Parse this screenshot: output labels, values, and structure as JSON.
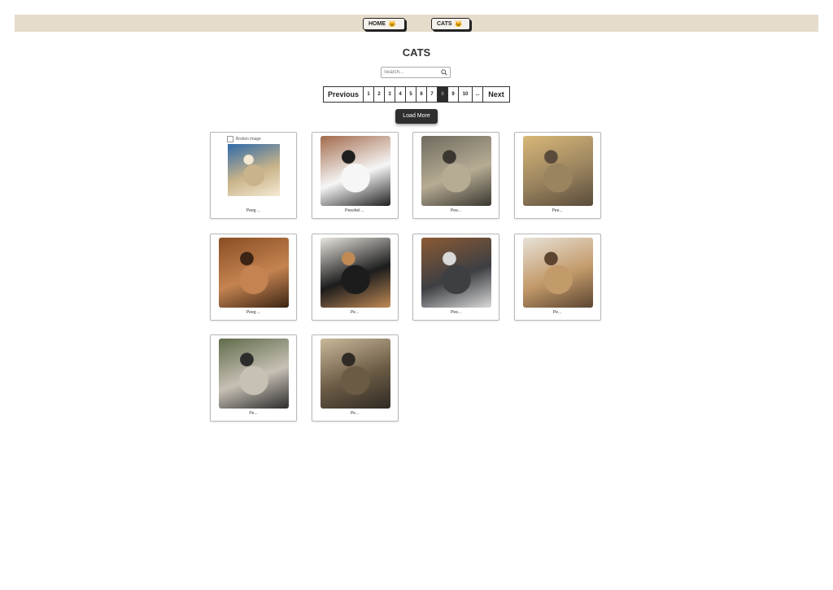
{
  "nav": {
    "home_label": "HOME",
    "cats_label": "CATS",
    "home_icon": "cat-icon",
    "cats_icon": "cat-icon"
  },
  "page": {
    "title": "CATS"
  },
  "search": {
    "placeholder": "Search..."
  },
  "pagination": {
    "previous_label": "Previous",
    "next_label": "Next",
    "pages": [
      "1",
      "2",
      "3",
      "4",
      "5",
      "6",
      "7",
      "8",
      "9",
      "10",
      "..."
    ],
    "active_page": "8"
  },
  "load_more": {
    "label": "Load More"
  },
  "cards": [
    {
      "caption": "Peeg ... ",
      "alt": "Broken image",
      "has_broken_image": true,
      "colors": [
        "#2e6aa8",
        "#c9b38a",
        "#f3e9d2"
      ]
    },
    {
      "caption": "Peeshel ...",
      "colors": [
        "#a26a4b",
        "#f6f6f6",
        "#1f1f1f"
      ]
    },
    {
      "caption": "Pee...",
      "colors": [
        "#6e6a5e",
        "#b6ac94",
        "#3a3730"
      ]
    },
    {
      "caption": "Pee...",
      "colors": [
        "#d8b777",
        "#9a845f",
        "#5a4b3a"
      ]
    },
    {
      "caption": "Peeg ...",
      "colors": [
        "#8a4e24",
        "#c48350",
        "#3b2414"
      ]
    },
    {
      "caption": "Pe...",
      "colors": [
        "#e9e6df",
        "#1c1c1c",
        "#c08a55"
      ]
    },
    {
      "caption": "Pee...",
      "colors": [
        "#8b5a34",
        "#3d3f43",
        "#d9d9d9"
      ]
    },
    {
      "caption": "Pe...",
      "colors": [
        "#e7e1d7",
        "#c39a6a",
        "#5b4531"
      ]
    },
    {
      "caption": "Pe...",
      "colors": [
        "#5f6b4a",
        "#c7c0b5",
        "#2c2c2c"
      ]
    },
    {
      "caption": "Pe...",
      "colors": [
        "#c9b89a",
        "#6b5b45",
        "#2f2a24"
      ]
    }
  ]
}
